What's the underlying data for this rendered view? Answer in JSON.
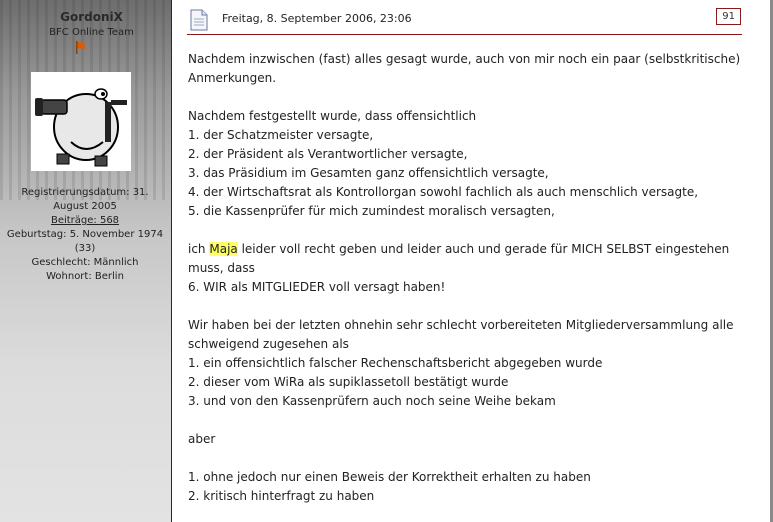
{
  "user": {
    "name": "GordoniX",
    "title": "BFC Online Team",
    "registered_label": "Registrierungsdatum: 31. August 2005",
    "posts_label": "Beiträge: 568",
    "birthday_label": "Geburtstag: 5. November 1974 (33)",
    "gender_label": "Geschlecht: Männlich",
    "location_label": "Wohnort: Berlin"
  },
  "post": {
    "date": "Freitag, 8. September 2006, 23:06",
    "number": "91",
    "paragraphs": [
      [
        "Nachdem inzwischen (fast) alles gesagt wurde, auch von mir noch ein paar (selbstkritische)",
        "Anmerkungen."
      ],
      [
        "Nachdem festgestellt wurde, dass offensichtlich",
        "1. der Schatzmeister versagte,",
        "2. der Präsident als Verantwortlicher versagte,",
        "3. das Präsidium im Gesamten ganz offensichtlich versagte,",
        "4. der Wirtschaftsrat als Kontrollorgan sowohl fachlich als auch menschlich versagte,",
        "5. die Kassenprüfer für mich zumindest moralisch versagten,"
      ],
      [
        "ich ",
        "Maja",
        " leider voll recht geben und leider auch und gerade für MICH SELBST eingestehen",
        "muss, dass",
        "6. WIR als MITGLIEDER voll versagt haben!"
      ],
      [
        "Wir haben bei der letzten ohnehin sehr schlecht vorbereiteten Mitgliederversammlung alle",
        "schweigend zugesehen als",
        "1. ein offensichtlich falscher Rechenschaftsbericht abgegeben wurde",
        "2. dieser vom WiRa als supiklassetoll bestätigt wurde",
        "3. und von den Kassenprüfern auch noch seine Weihe bekam"
      ],
      [
        "aber"
      ],
      [
        "1. ohne jedoch nur einen Beweis der Korrektheit erhalten zu haben",
        "2. kritisch hinterfragt zu haben"
      ]
    ]
  },
  "colors": {
    "accent": "#8a1a1a",
    "highlight": "#ffff66"
  }
}
